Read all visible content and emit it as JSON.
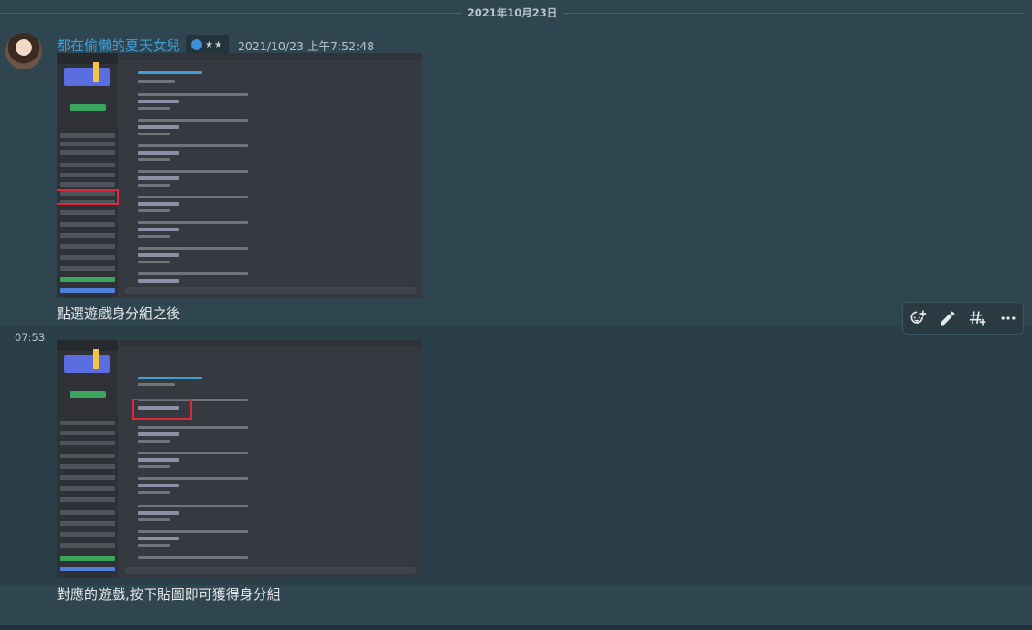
{
  "divider": {
    "date": "2021年10月23日"
  },
  "message1": {
    "username": "都在偷懶的夏天女兒",
    "badge_stars": "★★",
    "timestamp": "2021/10/23 上午7:52:48",
    "caption": "點選遊戲身分組之後"
  },
  "message2": {
    "short_time": "07:53",
    "caption": "對應的遊戲,按下貼圖即可獲得身分組"
  },
  "toolbar": {
    "icons": [
      "add-reaction-icon",
      "edit-icon",
      "create-thread-icon",
      "more-icon"
    ]
  },
  "colors": {
    "background": "#2f4550",
    "username": "#3fa0d8",
    "highlight": "#e0283a"
  }
}
